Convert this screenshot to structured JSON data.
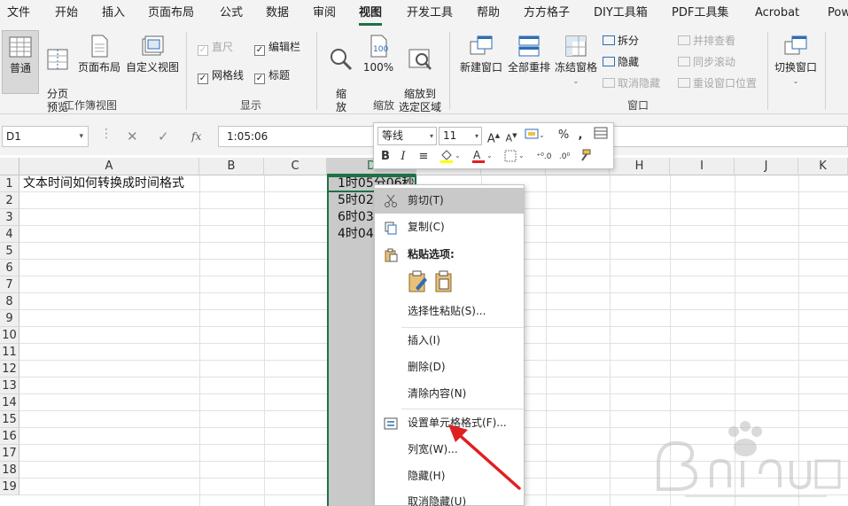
{
  "menu": {
    "tabs": [
      {
        "label": "文件"
      },
      {
        "label": "开始"
      },
      {
        "label": "插入"
      },
      {
        "label": "页面布局"
      },
      {
        "label": "公式"
      },
      {
        "label": "数据"
      },
      {
        "label": "审阅"
      },
      {
        "label": "视图"
      },
      {
        "label": "开发工具"
      },
      {
        "label": "帮助"
      },
      {
        "label": "方方格子"
      },
      {
        "label": "DIY工具箱"
      },
      {
        "label": "PDF工具集"
      },
      {
        "label": "Acrobat"
      },
      {
        "label": "Pow"
      }
    ],
    "active": "视图"
  },
  "ribbon": {
    "workbook_views": {
      "group_label": "工作簿视图",
      "normal": "普通",
      "page_break_preview": "分页\n预览",
      "page_layout": "页面布局",
      "custom_views": "自定义视图"
    },
    "show": {
      "group_label": "显示",
      "ruler": "直尺",
      "formula_bar": "编辑栏",
      "gridlines": "网格线",
      "headings": "标题"
    },
    "zoom": {
      "group_label": "缩放",
      "zoom": "缩\n放",
      "zoom_100": "100%",
      "zoom_selection": "缩放到\n选定区域"
    },
    "window": {
      "group_label": "窗口",
      "new_window": "新建窗口",
      "arrange_all": "全部重排",
      "freeze_panes": "冻结窗格",
      "split": "拆分",
      "hide": "隐藏",
      "unhide": "取消隐藏",
      "side_by_side": "并排查看",
      "sync_scroll": "同步滚动",
      "reset_position": "重设窗口位置",
      "switch_windows": "切换窗口"
    }
  },
  "formula_bar": {
    "name_box": "D1",
    "fx": "fx",
    "formula": "1:05:06"
  },
  "grid": {
    "columns": [
      "A",
      "B",
      "C",
      "D",
      "",
      "",
      "H",
      "I",
      "J",
      "K"
    ],
    "rows": [
      "1",
      "2",
      "3",
      "4",
      "5",
      "6",
      "7",
      "8",
      "9",
      "10",
      "11",
      "12",
      "13",
      "14",
      "15",
      "16",
      "17",
      "18",
      "19"
    ],
    "A1": "文本时间如何转换成时间格式",
    "D_values": [
      "1时05分06秒",
      "5时02",
      "6时03",
      "4时04"
    ]
  },
  "mini_toolbar": {
    "font": "等线",
    "size": "11",
    "bold": "B",
    "italic": "I",
    "percent": "%",
    "comma": ","
  },
  "context_menu": {
    "cut": "剪切(T)",
    "copy": "复制(C)",
    "paste_options": "粘贴选项:",
    "paste_special": "选择性粘贴(S)...",
    "insert": "插入(I)",
    "delete": "删除(D)",
    "clear_contents": "清除内容(N)",
    "format_cells": "设置单元格格式(F)...",
    "column_width": "列宽(W)...",
    "hide": "隐藏(H)",
    "unhide": "取消隐藏(U)"
  },
  "colors": {
    "excel_green": "#1e7145",
    "annotation_arrow": "#e02020"
  }
}
